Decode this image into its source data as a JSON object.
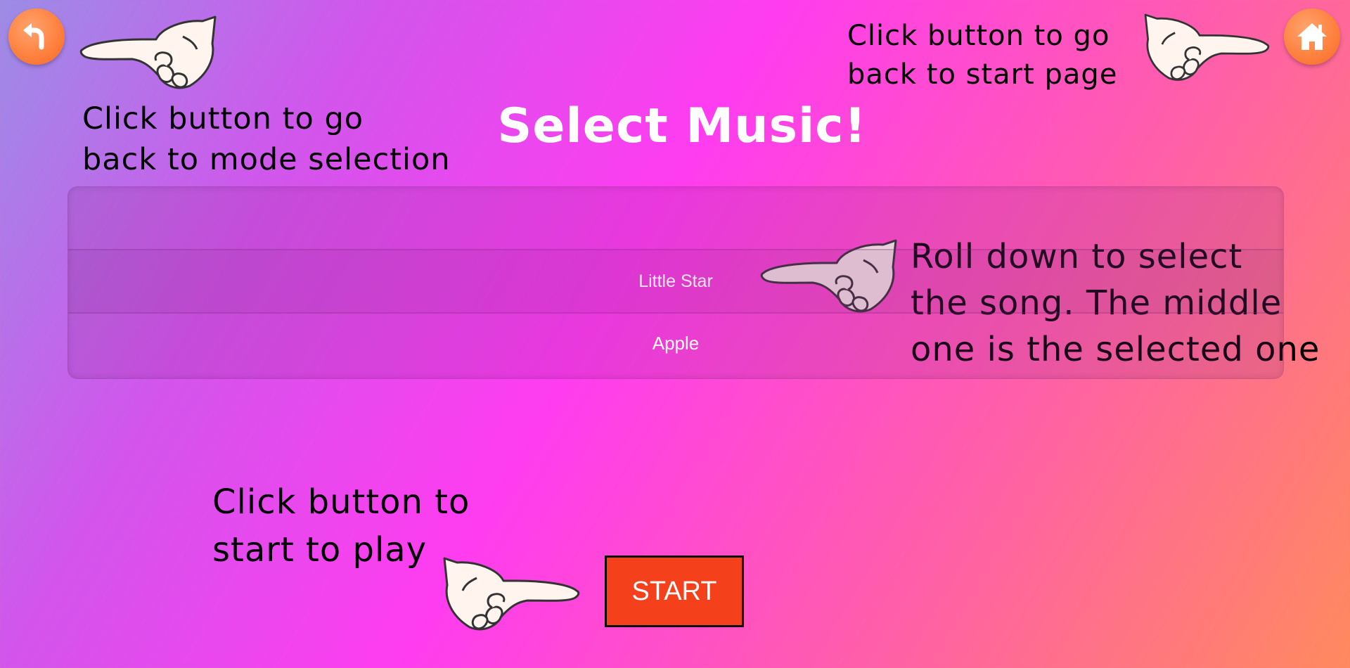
{
  "header": {
    "title": "Select Music!",
    "back_button_icon": "back-arrow-icon",
    "home_button_icon": "home-icon"
  },
  "hints": {
    "back": "Click button to go\nback to mode selection",
    "home": "Click button to go\nback to start page",
    "roll": "Roll down to select\nthe song. The middle\none is the selected one",
    "start": "Click button to\nstart to play"
  },
  "song_picker": {
    "rows": [
      "",
      "Little Star",
      "Apple"
    ],
    "selected": "Little Star"
  },
  "start_button": {
    "label": "START"
  },
  "colors": {
    "accent_orange": "#ff7f3c",
    "start_red": "#f5401c",
    "hand_fill": "#fff4ee"
  }
}
